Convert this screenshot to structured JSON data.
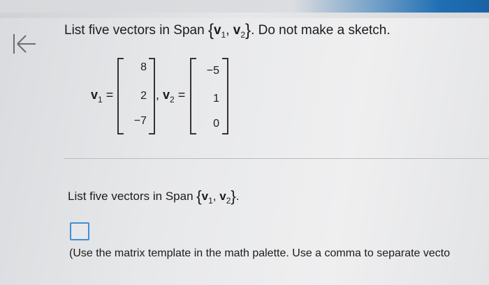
{
  "question": {
    "intro": "List five vectors in Span",
    "span_open": "{",
    "v1": "v",
    "v1_sub": "1",
    "comma": ",",
    "v2": "v",
    "v2_sub": "2",
    "span_close": "}",
    "after": ". Do not make a sketch."
  },
  "vectors": {
    "v1_label": "v",
    "v1_label_sub": "1",
    "equals": "=",
    "v1_values": [
      "8",
      "2",
      "−7"
    ],
    "separator": ",",
    "v2_label": "v",
    "v2_label_sub": "2",
    "v2_values": [
      "−5",
      "1",
      "0"
    ]
  },
  "answer": {
    "prompt": "List five vectors in Span",
    "span_open": "{",
    "v1": "v",
    "v1_sub": "1",
    "comma": ",",
    "v2": "v",
    "v2_sub": "2",
    "span_close": "}",
    "period": ".",
    "hint": "(Use the matrix template in the math palette. Use a comma to separate vecto"
  },
  "icons": {
    "back": "back-arrow-icon"
  },
  "colors": {
    "accent": "#3f8fd6",
    "top_bar_blue": "#1f6fb4"
  }
}
